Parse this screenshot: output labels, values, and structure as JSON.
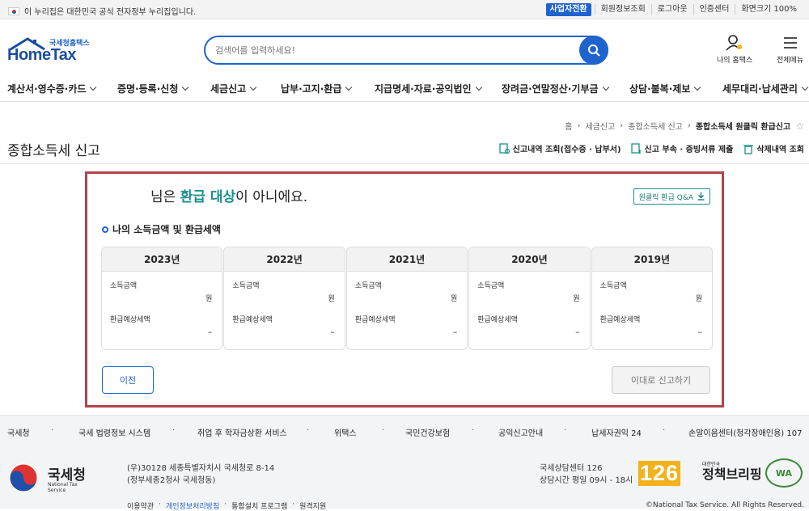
{
  "gov_bar": {
    "notice": "이 누리집은 대한민국 공식 전자정부 누리집입니다.",
    "biz_switch": "사업자전환",
    "links": [
      "회원정보조회",
      "로그아웃",
      "인증센터",
      "화면크기 100%"
    ]
  },
  "header": {
    "logo_small": "국세청홈택스",
    "logo_big": "HomeTax",
    "search_placeholder": "검색어를 입력하세요!",
    "my_home": "나의 홈택스",
    "all_menu": "전체메뉴"
  },
  "nav": {
    "items": [
      "계산서·영수증·카드",
      "증명·등록·신청",
      "세금신고",
      "납부·고지·환급",
      "지급명세·자료·공익법인",
      "장려금·연말정산·기부금",
      "상담·불복·제보",
      "세무대리·납세관리"
    ]
  },
  "breadcrumb": [
    "홈",
    "세금신고",
    "종합소득세 신고",
    "종합소득세 원클릭 환급신고"
  ],
  "page_title": "종합소득세 신고",
  "top_actions": [
    "신고내역 조회(접수증 · 납부서)",
    "신고 부속 · 증빙서류 제출",
    "삭제내역 조회"
  ],
  "modal": {
    "title_prefix": "님은 ",
    "title_highlight": "환급 대상",
    "title_suffix": "이 아니에요.",
    "qa_button": "원클릭 환급 Q&A",
    "subtitle": "나의 소득금액 및 환급세액",
    "income_label": "소득금액",
    "income_unit": "원",
    "refund_label": "환급예상세액",
    "years": [
      {
        "year": "2023년",
        "refund": "–"
      },
      {
        "year": "2022년",
        "refund": "–"
      },
      {
        "year": "2021년",
        "refund": "–"
      },
      {
        "year": "2020년",
        "refund": "–"
      },
      {
        "year": "2019년",
        "refund": "–"
      }
    ],
    "prev_button": "이전",
    "proceed_button": "이대로 신고하기"
  },
  "footer_links": [
    "국세청",
    "국세 법령정보 시스템",
    "취업 후 학자금상환 서비스",
    "위택스",
    "국민건강보험",
    "공익신고안내",
    "납세자권익 24",
    "손말이음센터(청각장애인용) 107"
  ],
  "footer": {
    "org_name": "국세청",
    "org_en": "National Tax Service",
    "address1": "(우)30128 세종특별자치시 국세청로 8-14",
    "address2": "(정부세종2청사 국세청동)",
    "call_center": "국세상담센터 126",
    "call_hours": "상담시간 평일 09시 - 18시",
    "badge_126": "126",
    "briefing_small": "대한민국",
    "briefing": "정책브리핑",
    "wa_mark": "WA",
    "bottom_links": [
      "이용약관",
      "개인정보처리방침",
      "통합설치 프로그램",
      "원격지원"
    ],
    "copyright": "©National Tax Service. All Rights Reserved."
  },
  "colors": {
    "primary": "#1f63cf",
    "teal": "#1a8f8f",
    "highlight_border": "#b5434a"
  }
}
